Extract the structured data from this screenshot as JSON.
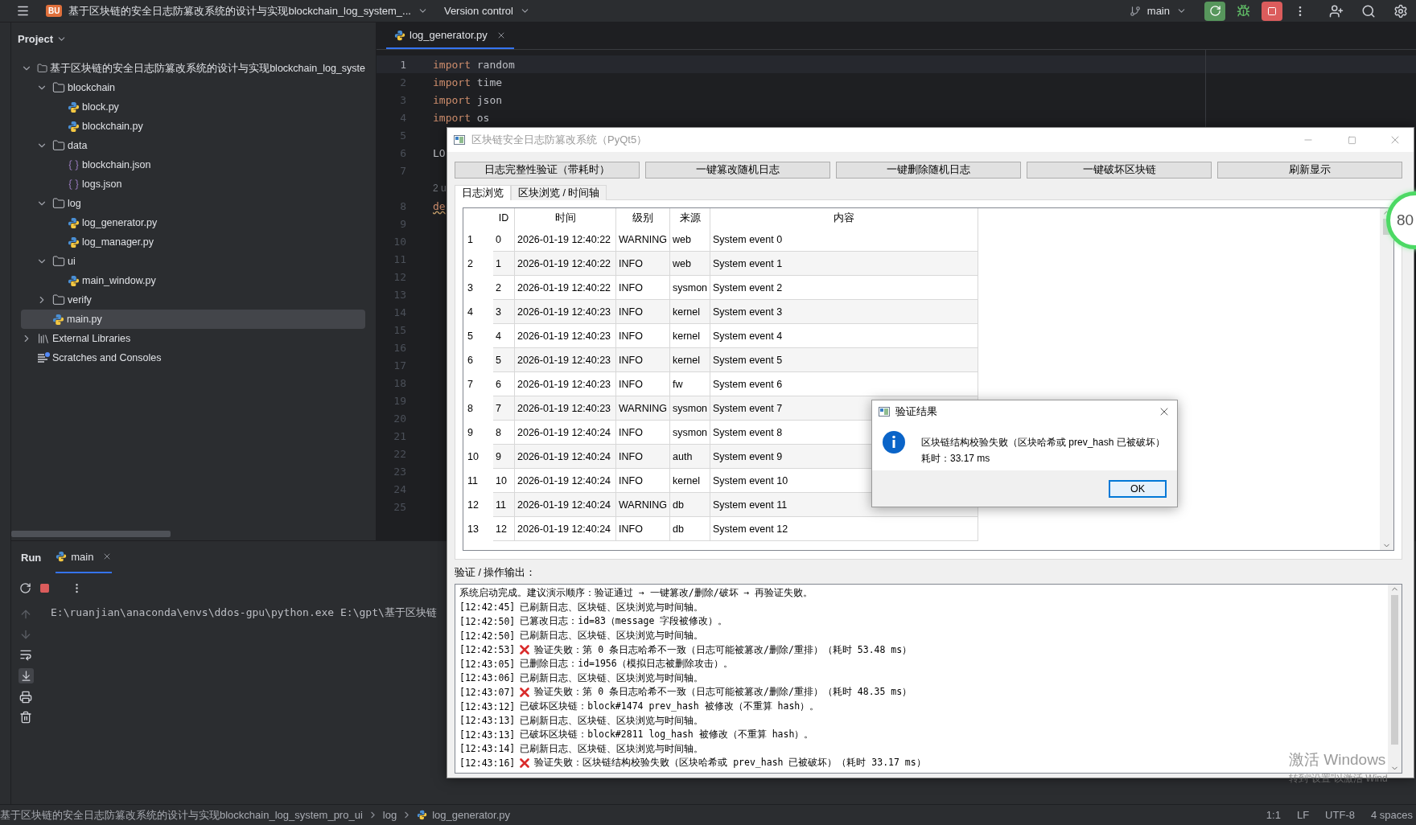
{
  "topbar": {
    "project_badge": "BU",
    "project_title": "基于区块链的安全日志防篡改系统的设计与实现blockchain_log_system_...",
    "vcs_menu": "Version control",
    "branch": "main"
  },
  "project_panel": {
    "title": "Project",
    "tree": [
      {
        "name": "基于区块链的安全日志防篡改系统的设计与实现blockchain_log_syste",
        "kind": "folder",
        "expanded": true,
        "selected": false,
        "children": [
          {
            "name": "blockchain",
            "kind": "folder",
            "expanded": true,
            "selected": false,
            "children": [
              {
                "name": "block.py",
                "kind": "python",
                "selected": false
              },
              {
                "name": "blockchain.py",
                "kind": "python",
                "selected": false
              }
            ]
          },
          {
            "name": "data",
            "kind": "folder",
            "expanded": true,
            "selected": false,
            "children": [
              {
                "name": "blockchain.json",
                "kind": "json",
                "selected": false
              },
              {
                "name": "logs.json",
                "kind": "json",
                "selected": false
              }
            ]
          },
          {
            "name": "log",
            "kind": "folder",
            "expanded": true,
            "selected": false,
            "children": [
              {
                "name": "log_generator.py",
                "kind": "python",
                "selected": false
              },
              {
                "name": "log_manager.py",
                "kind": "python",
                "selected": false
              }
            ]
          },
          {
            "name": "ui",
            "kind": "folder",
            "expanded": true,
            "selected": false,
            "children": [
              {
                "name": "main_window.py",
                "kind": "python",
                "selected": false
              }
            ]
          },
          {
            "name": "verify",
            "kind": "folder",
            "expanded": false,
            "selected": false
          },
          {
            "name": "main.py",
            "kind": "python",
            "selected": true
          }
        ]
      },
      {
        "name": "External Libraries",
        "kind": "library",
        "expanded": false,
        "selected": false
      },
      {
        "name": "Scratches and Consoles",
        "kind": "scratches",
        "selected": false
      }
    ]
  },
  "editor": {
    "tabs": [
      {
        "label": "log_generator.py",
        "selected": true
      }
    ],
    "lines": [
      {
        "kind": "code",
        "number": "1",
        "keyword": "import",
        "text": "random",
        "current": true
      },
      {
        "kind": "code",
        "number": "2",
        "keyword": "import",
        "text": "time",
        "current": false
      },
      {
        "kind": "code",
        "number": "3",
        "keyword": "import",
        "text": "json",
        "current": false
      },
      {
        "kind": "code",
        "number": "4",
        "keyword": "import",
        "text": "os",
        "current": false
      },
      {
        "kind": "code",
        "number": "5",
        "current": false
      },
      {
        "kind": "code",
        "number": "6",
        "text": "LO",
        "current": false
      },
      {
        "kind": "code",
        "number": "7",
        "current": false
      },
      {
        "kind": "inlay",
        "text": "2 u"
      },
      {
        "kind": "code",
        "number": "8",
        "keyword": "de",
        "warning": true,
        "current": false
      },
      {
        "kind": "code",
        "number": "9",
        "current": false
      },
      {
        "kind": "code",
        "number": "10",
        "current": false
      },
      {
        "kind": "code",
        "number": "11",
        "current": false
      },
      {
        "kind": "code",
        "number": "12",
        "current": false
      },
      {
        "kind": "code",
        "number": "13",
        "current": false
      },
      {
        "kind": "code",
        "number": "14",
        "current": false
      },
      {
        "kind": "code",
        "number": "15",
        "current": false
      },
      {
        "kind": "code",
        "number": "16",
        "current": false
      },
      {
        "kind": "code",
        "number": "17",
        "current": false
      },
      {
        "kind": "code",
        "number": "18",
        "current": false
      },
      {
        "kind": "code",
        "number": "19",
        "current": false
      },
      {
        "kind": "code",
        "number": "20",
        "current": false
      },
      {
        "kind": "code",
        "number": "21",
        "current": false
      },
      {
        "kind": "code",
        "number": "22",
        "current": false
      },
      {
        "kind": "code",
        "number": "23",
        "current": false
      },
      {
        "kind": "code",
        "number": "24",
        "current": false
      },
      {
        "kind": "code",
        "number": "25",
        "current": false
      }
    ]
  },
  "run_panel": {
    "title": "Run",
    "tabs": [
      {
        "label": "main",
        "selected": true
      }
    ],
    "command": "E:\\ruanjian\\anaconda\\envs\\ddos-gpu\\python.exe E:\\gpt\\基于区块链"
  },
  "app_window": {
    "title": "区块链安全日志防篡改系统（PyQt5）",
    "buttons": [
      "日志完整性验证（带耗时）",
      "一键篡改随机日志",
      "一键删除随机日志",
      "一键破坏区块链",
      "刷新显示"
    ],
    "tabs": [
      {
        "label": "日志浏览",
        "selected": true
      },
      {
        "label": "区块浏览 / 时间轴",
        "selected": false
      }
    ],
    "table": {
      "columns": [
        "ID",
        "时间",
        "级别",
        "来源",
        "内容"
      ],
      "rows": [
        {
          "row": "1",
          "cells": [
            "0",
            "2026-01-19 12:40:22",
            "WARNING",
            "web",
            "System event 0"
          ]
        },
        {
          "row": "2",
          "cells": [
            "1",
            "2026-01-19 12:40:22",
            "INFO",
            "web",
            "System event 1"
          ]
        },
        {
          "row": "3",
          "cells": [
            "2",
            "2026-01-19 12:40:22",
            "INFO",
            "sysmon",
            "System event 2"
          ]
        },
        {
          "row": "4",
          "cells": [
            "3",
            "2026-01-19 12:40:23",
            "INFO",
            "kernel",
            "System event 3"
          ]
        },
        {
          "row": "5",
          "cells": [
            "4",
            "2026-01-19 12:40:23",
            "INFO",
            "kernel",
            "System event 4"
          ]
        },
        {
          "row": "6",
          "cells": [
            "5",
            "2026-01-19 12:40:23",
            "INFO",
            "kernel",
            "System event 5"
          ]
        },
        {
          "row": "7",
          "cells": [
            "6",
            "2026-01-19 12:40:23",
            "INFO",
            "fw",
            "System event 6"
          ]
        },
        {
          "row": "8",
          "cells": [
            "7",
            "2026-01-19 12:40:23",
            "WARNING",
            "sysmon",
            "System event 7"
          ]
        },
        {
          "row": "9",
          "cells": [
            "8",
            "2026-01-19 12:40:24",
            "INFO",
            "sysmon",
            "System event 8"
          ]
        },
        {
          "row": "10",
          "cells": [
            "9",
            "2026-01-19 12:40:24",
            "INFO",
            "auth",
            "System event 9"
          ]
        },
        {
          "row": "11",
          "cells": [
            "10",
            "2026-01-19 12:40:24",
            "INFO",
            "kernel",
            "System event 10"
          ]
        },
        {
          "row": "12",
          "cells": [
            "11",
            "2026-01-19 12:40:24",
            "WARNING",
            "db",
            "System event 11"
          ]
        },
        {
          "row": "13",
          "cells": [
            "12",
            "2026-01-19 12:40:24",
            "INFO",
            "db",
            "System event 12"
          ]
        }
      ]
    },
    "output_label": "验证 / 操作输出：",
    "output_lines": [
      {
        "kind": "info",
        "text": "系统启动完成。建议演示顺序：验证通过 → 一键篡改/删除/破坏 → 再验证失败。"
      },
      {
        "kind": "info",
        "time": "[12:42:45]",
        "text": "已刷新日志、区块链、区块浏览与时间轴。"
      },
      {
        "kind": "info",
        "time": "[12:42:50]",
        "text": "已篡改日志：id=83（message 字段被修改）。"
      },
      {
        "kind": "info",
        "time": "[12:42:50]",
        "text": "已刷新日志、区块链、区块浏览与时间轴。"
      },
      {
        "kind": "fail",
        "time": "[12:42:53]",
        "text": "验证失败：第 0 条日志哈希不一致（日志可能被篡改/删除/重排）（耗时 53.48 ms）"
      },
      {
        "kind": "info",
        "time": "[12:43:05]",
        "text": "已删除日志：id=1956（模拟日志被删除攻击）。"
      },
      {
        "kind": "info",
        "time": "[12:43:06]",
        "text": "已刷新日志、区块链、区块浏览与时间轴。"
      },
      {
        "kind": "fail",
        "time": "[12:43:07]",
        "text": "验证失败：第 0 条日志哈希不一致（日志可能被篡改/删除/重排）（耗时 48.35 ms）"
      },
      {
        "kind": "info",
        "time": "[12:43:12]",
        "text": "已破坏区块链：block#1474 prev_hash 被修改（不重算 hash）。"
      },
      {
        "kind": "info",
        "time": "[12:43:13]",
        "text": "已刷新日志、区块链、区块浏览与时间轴。"
      },
      {
        "kind": "info",
        "time": "[12:43:13]",
        "text": "已破坏区块链：block#2811 log_hash 被修改（不重算 hash）。"
      },
      {
        "kind": "info",
        "time": "[12:43:14]",
        "text": "已刷新日志、区块链、区块浏览与时间轴。"
      },
      {
        "kind": "fail",
        "time": "[12:43:16]",
        "text": "验证失败：区块链结构校验失败（区块哈希或 prev_hash 已被破坏）（耗时 33.17 ms）"
      }
    ]
  },
  "dialog": {
    "title": "验证结果",
    "message": "区块链结构校验失败（区块哈希或 prev_hash 已被破坏）",
    "detail": "耗时：33.17 ms",
    "button": "OK"
  },
  "progress_badge": {
    "text": "80"
  },
  "activation_notice": {
    "title": "激活 Windows",
    "hint": "转到“设置”以激活 Wind"
  },
  "status_bar": {
    "breadcrumbs": [
      "基于区块链的安全日志防篡改系统的设计与实现blockchain_log_system_pro_ui",
      "log",
      "log_generator.py"
    ],
    "position": "1:1",
    "line_separator": "LF",
    "encoding": "UTF-8",
    "indent": "4 spaces"
  }
}
